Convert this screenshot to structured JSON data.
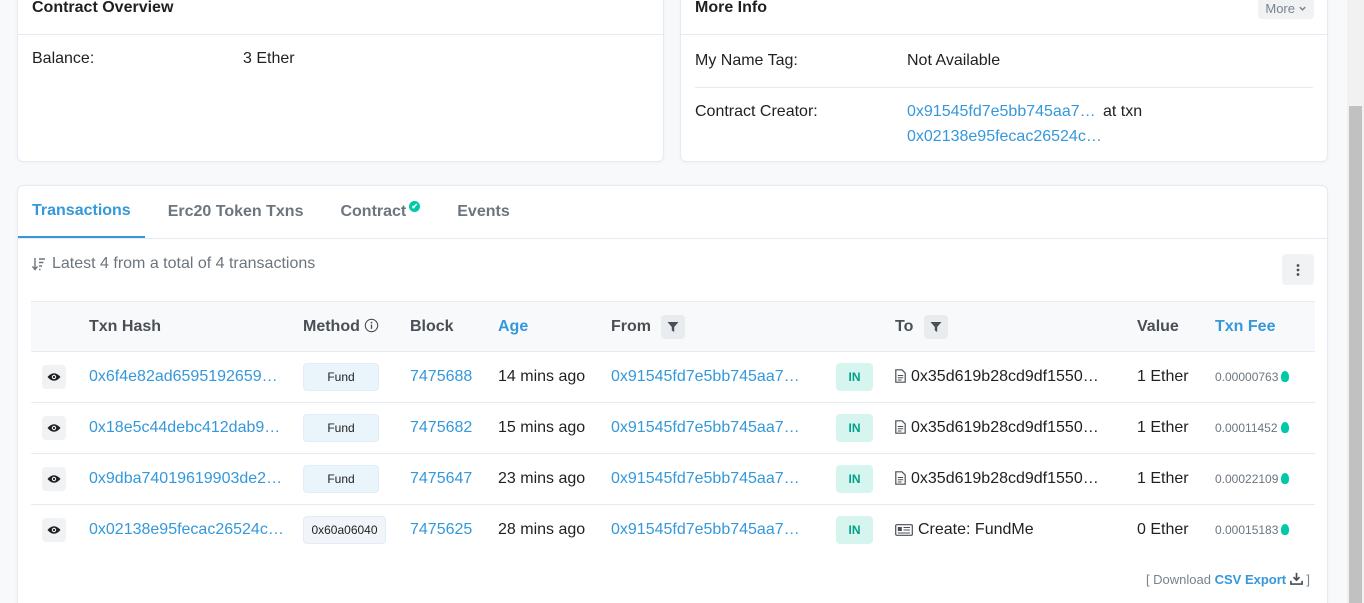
{
  "overview": {
    "title": "Contract Overview",
    "balance_label": "Balance:",
    "balance_value": "3 Ether"
  },
  "more_info": {
    "title": "More Info",
    "more_button": "More",
    "name_tag_label": "My Name Tag:",
    "name_tag_value": "Not Available",
    "creator_label": "Contract Creator:",
    "creator_address": "0x91545fd7e5bb745aa7…",
    "at_txn": "at txn",
    "creator_txn": "0x02138e95fecac26524c…"
  },
  "tabs": [
    {
      "label": "Transactions",
      "active": true
    },
    {
      "label": "Erc20 Token Txns",
      "active": false
    },
    {
      "label": "Contract",
      "active": false,
      "verified": true
    },
    {
      "label": "Events",
      "active": false
    }
  ],
  "summary": "Latest 4 from a total of 4 transactions",
  "table": {
    "headers": {
      "txn_hash": "Txn Hash",
      "method": "Method",
      "block": "Block",
      "age": "Age",
      "from": "From",
      "to": "To",
      "value": "Value",
      "txn_fee": "Txn Fee"
    },
    "rows": [
      {
        "hash": "0x6f4e82ad6595192659…",
        "method": "Fund",
        "block": "7475688",
        "age": "14 mins ago",
        "from": "0x91545fd7e5bb745aa7…",
        "direction": "IN",
        "to": "0x35d619b28cd9df1550…",
        "value": "1 Ether",
        "fee": "0.00000763"
      },
      {
        "hash": "0x18e5c44debc412dab9…",
        "method": "Fund",
        "block": "7475682",
        "age": "15 mins ago",
        "from": "0x91545fd7e5bb745aa7…",
        "direction": "IN",
        "to": "0x35d619b28cd9df1550…",
        "value": "1 Ether",
        "fee": "0.00011452"
      },
      {
        "hash": "0x9dba74019619903de2…",
        "method": "Fund",
        "block": "7475647",
        "age": "23 mins ago",
        "from": "0x91545fd7e5bb745aa7…",
        "direction": "IN",
        "to": "0x35d619b28cd9df1550…",
        "value": "1 Ether",
        "fee": "0.00022109"
      },
      {
        "hash": "0x02138e95fecac26524c…",
        "method": "0x60a06040",
        "block": "7475625",
        "age": "28 mins ago",
        "from": "0x91545fd7e5bb745aa7…",
        "direction": "IN",
        "to": "Create: FundMe",
        "value": "0 Ether",
        "fee": "0.00015183"
      }
    ]
  },
  "download": {
    "prefix": "[ Download",
    "link": "CSV Export",
    "suffix": "]"
  },
  "colors": {
    "link": "#3498db",
    "success": "#00c9a7",
    "in_badge_bg": "#d6f5ef"
  }
}
